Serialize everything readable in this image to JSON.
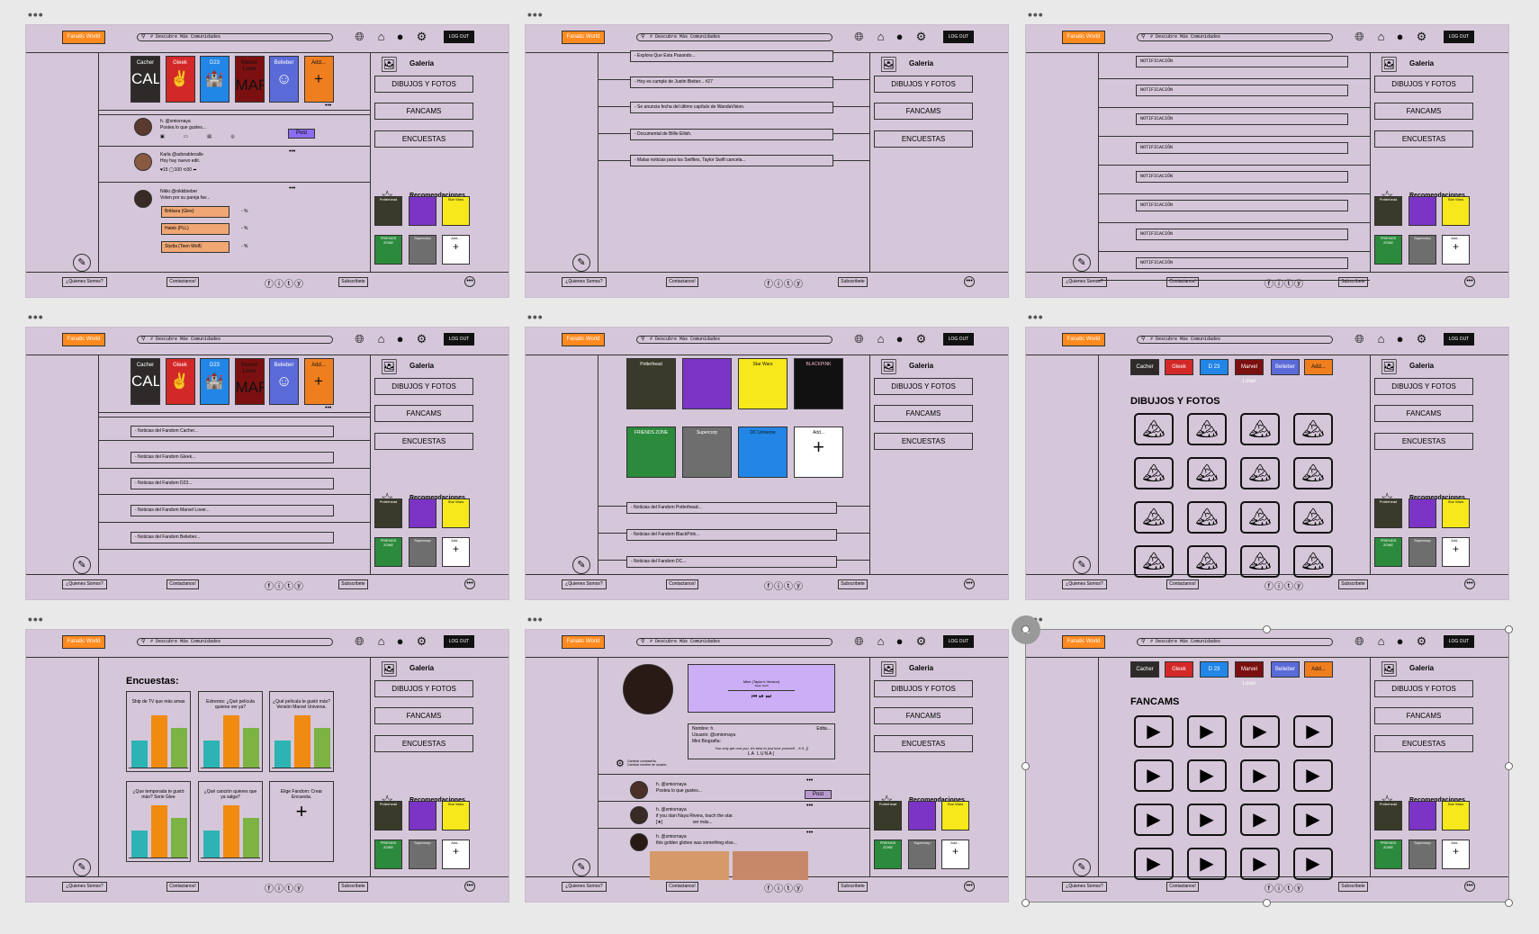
{
  "header": {
    "logo": "Fanatic World",
    "search": "# Descubre  Más  Comunidades",
    "logout": "LOG OUT"
  },
  "footer": {
    "about": "¿Quienes Somos?",
    "contact": "Contactanos!",
    "subscribe": "Subscribete",
    "social": "ⓕⓘⓣⓨ"
  },
  "sidebar": {
    "gallery": "Galeria",
    "drawings": "DIBUJOS Y FOTOS",
    "fancams": "FANCAMS",
    "polls": "ENCUESTAS",
    "recommendations": "Recomendaciones",
    "rec": [
      "Potterhead",
      "",
      "Star Wars",
      "FRIENDS ZONE",
      "Supercorp",
      "Add..."
    ]
  },
  "communities": [
    {
      "name": "Cacher",
      "bg": "#2f2a2a",
      "fg": "#ffffff",
      "glyph": "CALLE"
    },
    {
      "name": "Gleek",
      "bg": "#d32828",
      "fg": "#ffffff",
      "glyph": "✌"
    },
    {
      "name": "D23",
      "bg": "#2186e6",
      "fg": "#ffffff",
      "glyph": "🏰"
    },
    {
      "name": "Marvel Lover",
      "bg": "#7c1010",
      "fg": "#111111",
      "glyph": "MARVEL"
    },
    {
      "name": "Belieber",
      "bg": "#5a6bd8",
      "fg": "#ffffff",
      "glyph": "☺"
    },
    {
      "name": "Add...",
      "bg": "#ef7e1f",
      "fg": "#111111",
      "glyph": "+"
    }
  ],
  "feed": {
    "post_user": "h. @smiornaya",
    "post_placeholder": "Postea lo que gustes...",
    "post_button": "Post",
    "p1_user": "Karla @adorablecalle",
    "p1_text": "Hoy hay nuevo edit.",
    "p1_stats": "♥15  ◯100  ⟲30  ➦",
    "p2_user": "Nikki @nikkibieber",
    "p2_text": "Voten por su pareja fav...",
    "options": [
      "Brittana (Glee)",
      "Haleb (PLL)",
      "Stydia (Teen Wolf)"
    ],
    "pct": "- %"
  },
  "news_frame2": [
    "- Explora Que Esta Pasando...",
    "- Hoy es cumple de Justin Bieber... #27",
    "- Se anuncia fecha del último capítulo de WandaVision.",
    "- Documental de Billie Eilish.",
    "- Malas noticias para los Swifties, Taylor Swift cancela..."
  ],
  "notifications": "NOTIFICACIÓN",
  "news_frame4": [
    "- Noticias del Fandom Cacher...",
    "- Noticias del Fandom Gleek...",
    "- Noticias del Fandom D23...",
    "- Noticias del Fandom Marvel Lover...",
    "- Noticias del Fandom Belieber..."
  ],
  "fandoms_frame5": [
    "Potterhead",
    "",
    "Star Wars",
    "BLACKPINK",
    "FRIENDS ZONE",
    "Supercorp",
    "DC Universe",
    "Add..."
  ],
  "news_frame5": [
    "- Noticias del Fandom Potterhead...",
    "- Noticias del Fandom BlackPink...",
    "- Noticias del Fandom DC..."
  ],
  "pills": [
    "Cacher",
    "Gleek",
    "D 23",
    "Marvel Lover",
    "Belieber",
    "Add..."
  ],
  "drawings_title": "DIBUJOS Y FOTOS",
  "fancams_title": "FANCAMS",
  "polls_title": "Encuestas:",
  "polls": [
    "Ship de TV que más amas",
    "Estrenos: ¿Qué película quieres ver ya?",
    "¿Qué película te gustó más? Versión Marvel Universe.",
    "¿Que temporada te gustó más? Serie Glee",
    "¿Qué canción quieres que ya salga?",
    "Elige Fandom: Crear Encuesta."
  ],
  "profile": {
    "song": "Mine (Taylor's Version)",
    "artist": "Taylor Swift",
    "name": "Nombre: h.",
    "user": "Usuario: @smiornaya",
    "bio_label": "Mini Biografía:",
    "quote": "You only get one you, it's best to just love yourself. - 5.S. ]]",
    "luna": "LA  LUNA(",
    "edit": "Edita...",
    "settings": "Cambiar contraseña.\nCambiar nombre de usuario.",
    "posts": [
      {
        "user": "h. @smiornaya",
        "text": "Postea lo que gustes..."
      },
      {
        "user": "h. @smiornaya",
        "text": "if you stan Naya Rivera, touch the star.\n[★]                        ver más..."
      },
      {
        "user": "h. @smiornaya",
        "text": "this golden globes was something else..."
      }
    ]
  },
  "colors": {
    "frame": "#d5c7d9",
    "orange": "#ff8a1f",
    "bar_teal": "#2cb3b3",
    "bar_orange": "#f08a10",
    "bar_green": "#7cb342"
  }
}
